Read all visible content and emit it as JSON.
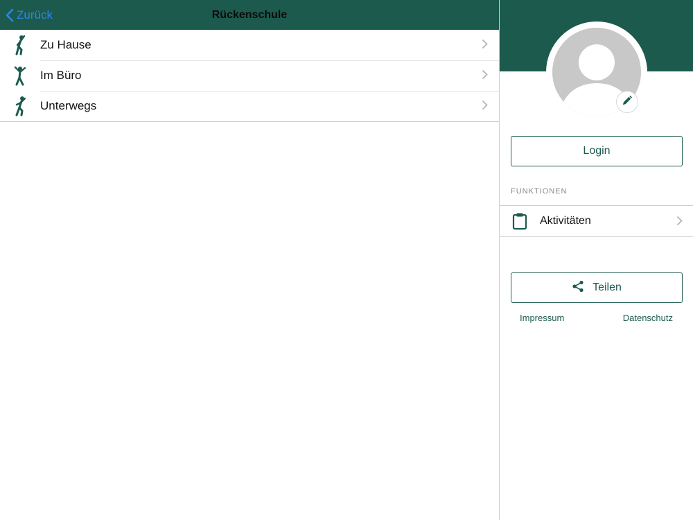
{
  "colors": {
    "brand": "#1c5a4e",
    "back_link": "#2f86e6",
    "chevron": "#b5b5b5",
    "avatar_placeholder": "#c8c8c8"
  },
  "navbar": {
    "back_label": "Zurück",
    "back_icon": "chevron-left-icon",
    "title": "Rückenschule"
  },
  "list": {
    "items": [
      {
        "label": "Zu Hause",
        "icon": "stretching-person-icon"
      },
      {
        "label": "Im Büro",
        "icon": "stretching-person-icon"
      },
      {
        "label": "Unterwegs",
        "icon": "stretching-person-icon"
      }
    ]
  },
  "profile": {
    "avatar_icon": "user-placeholder-icon",
    "edit_icon": "pencil-icon",
    "login_label": "Login"
  },
  "functions": {
    "section_label": "FUNKTIONEN",
    "items": [
      {
        "label": "Aktivitäten",
        "icon": "clipboard-icon"
      }
    ]
  },
  "share": {
    "label": "Teilen",
    "icon": "share-icon"
  },
  "footer": {
    "impressum": "Impressum",
    "datenschutz": "Datenschutz"
  }
}
